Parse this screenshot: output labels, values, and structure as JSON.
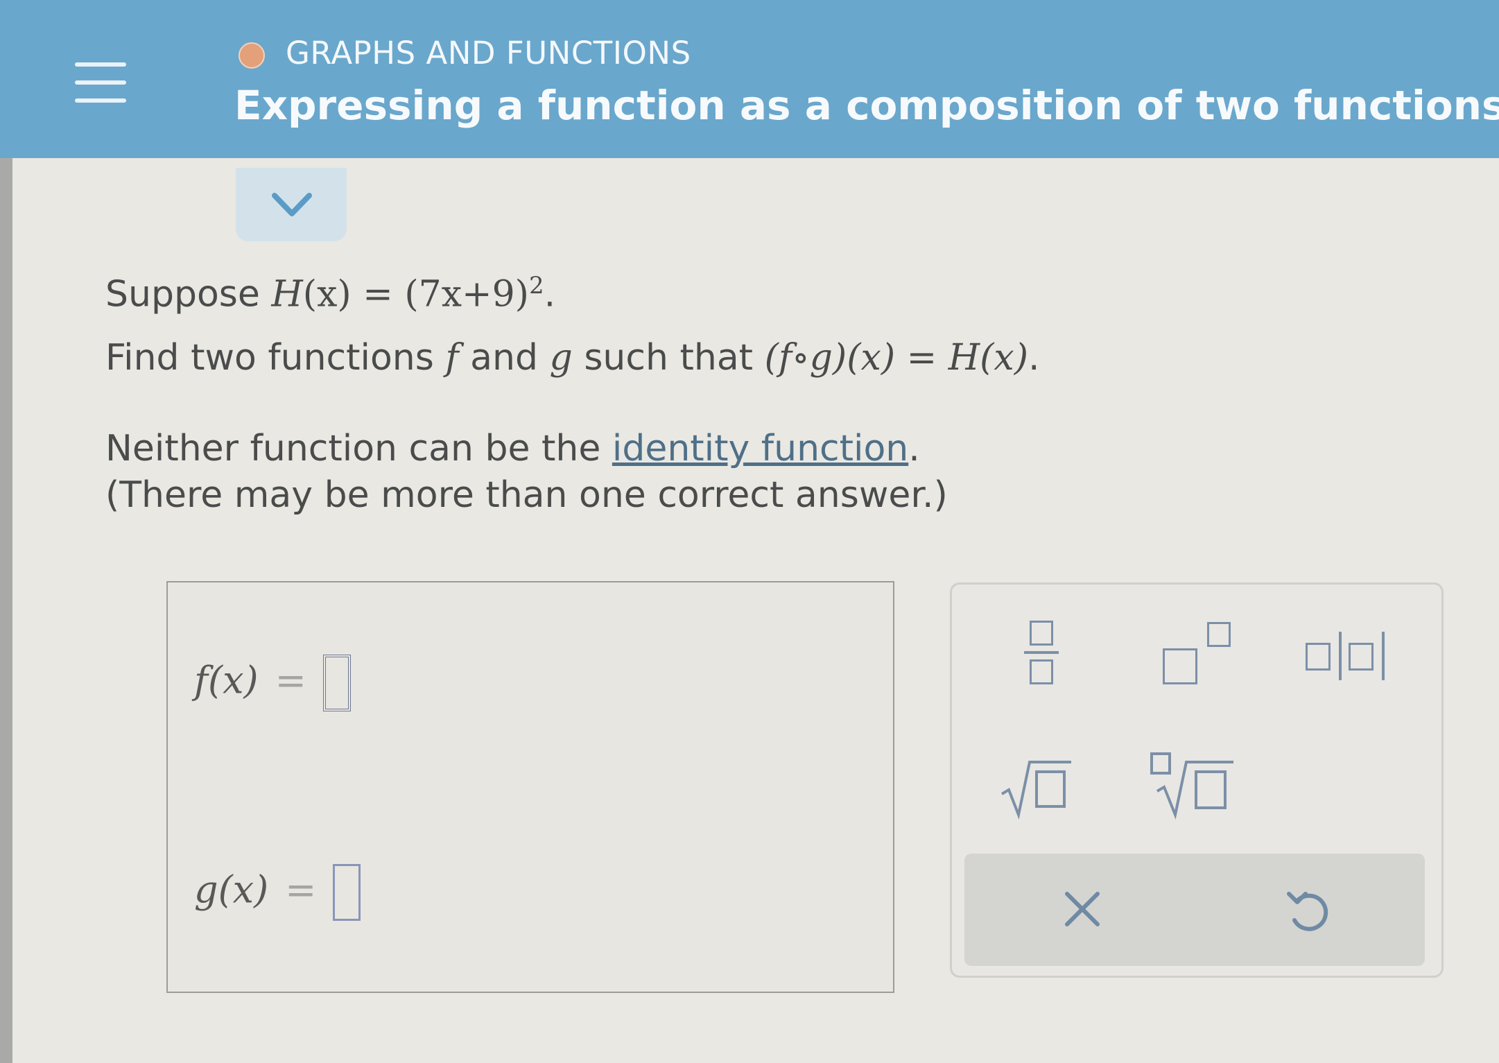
{
  "header": {
    "topic": "GRAPHS AND FUNCTIONS",
    "title": "Expressing a function as a composition of two functions"
  },
  "problem": {
    "suppose_word": "Suppose",
    "H_func": "H",
    "paren_x": "(x)",
    "equals": " = ",
    "expression": "(7x+9)",
    "exponent": "2",
    "period": ".",
    "find_text": "Find two functions ",
    "f_var": "f",
    "and_text": " and ",
    "g_var": "g",
    "such_text": " such that ",
    "composition": "(f∘g)(x) = H(x)",
    "neither_text": "Neither function can be the ",
    "identity_link": "identity function",
    "note_text": "(There may be more than one correct answer.)"
  },
  "answers": {
    "f_label": "f",
    "g_label": "g",
    "arg": "(x)",
    "eq": "=",
    "f_value": "",
    "g_value": ""
  },
  "palette": {
    "keys": [
      "fraction-icon",
      "power-icon",
      "absolute-value-icon",
      "sqrt-icon",
      "nth-root-icon"
    ],
    "actions": [
      "clear-icon",
      "undo-icon"
    ],
    "accent": "#7c8fa7"
  },
  "colors": {
    "header_bg": "#6aa7cc",
    "status_dot": "#e3a079",
    "link": "#4f6f87"
  }
}
